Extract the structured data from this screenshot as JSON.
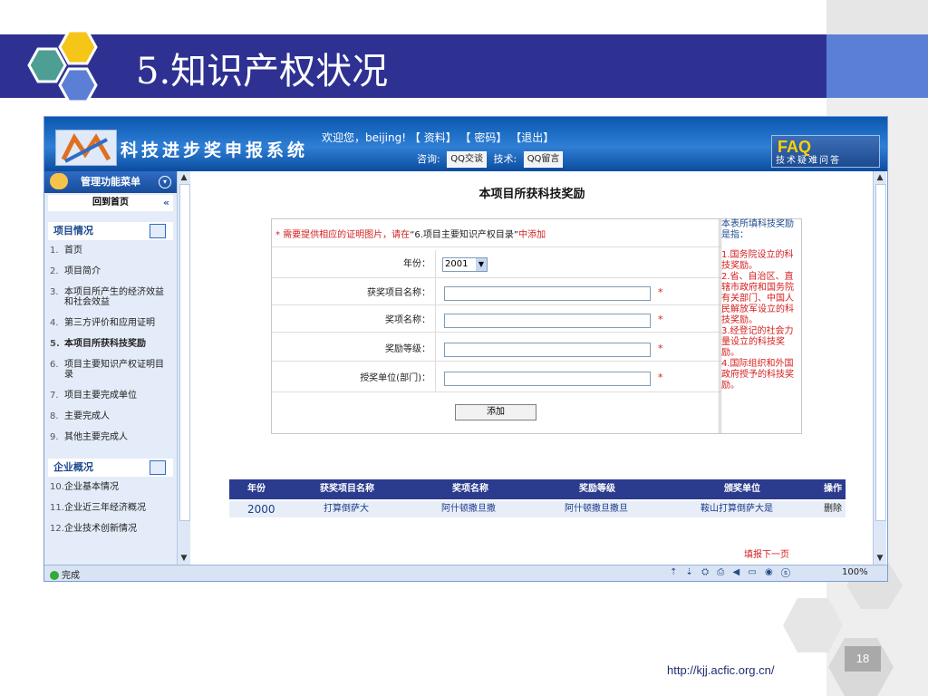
{
  "slide": {
    "title": "5.知识产权状况",
    "url": "http://kjj.acfic.org.cn/",
    "page_number": "18",
    "colors": {
      "title_bar": "#2e3192",
      "accent": "#5b7fd4"
    }
  },
  "app": {
    "name": "科技进步奖申报系统",
    "welcome": "欢迎您，beijing!",
    "links": [
      "【 资料】",
      "【 密码】",
      "【退出】"
    ],
    "consult_label": "咨询:",
    "qq_chat": "QQ交谈",
    "tech_label": "技术:",
    "qq_msg": "QQ留言",
    "faq_big": "FAQ",
    "faq_small": "技术疑难问答"
  },
  "sidebar": {
    "menu_title": "管理功能菜单",
    "back_home": "回到首页",
    "group1": "项目情况",
    "items": [
      {
        "idx": "1.",
        "label": "首页"
      },
      {
        "idx": "2.",
        "label": "项目简介"
      },
      {
        "idx": "3.",
        "label": "本项目所产生的经济效益和社会效益"
      },
      {
        "idx": "4.",
        "label": "第三方评价和应用证明"
      },
      {
        "idx": "5.",
        "label": "本项目所获科技奖励"
      },
      {
        "idx": "6.",
        "label": "项目主要知识产权证明目录"
      },
      {
        "idx": "7.",
        "label": "项目主要完成单位"
      },
      {
        "idx": "8.",
        "label": "主要完成人"
      },
      {
        "idx": "9.",
        "label": "其他主要完成人"
      }
    ],
    "group2": "企业概况",
    "items2": [
      {
        "idx": "10.",
        "label": "企业基本情况"
      },
      {
        "idx": "11.",
        "label": "企业近三年经济概况"
      },
      {
        "idx": "12.",
        "label": "企业技术创新情况"
      }
    ]
  },
  "main": {
    "page_title": "本项目所获科技奖励",
    "notice_prefix": "* 需要提供相应的证明图片，请在",
    "notice_link": "“6.项目主要知识产权目录”",
    "notice_suffix": "中添加",
    "year_label": "年份：",
    "year_value": "2001",
    "award_project_label": "获奖项目名称：",
    "award_name_label": "奖项名称：",
    "award_level_label": "奖励等级：",
    "award_unit_label": "授奖单位(部门)：",
    "add_button": "添加",
    "note_title": "本表所填科技奖励是指：",
    "note_items": [
      "1.国务院设立的科技奖励。",
      "2.省、自治区、直辖市政府和国务院有关部门、中国人民解放军设立的科技奖励。",
      "3.经登记的社会力量设立的科技奖励。",
      "4.国际组织和外国政府授予的科技奖励。"
    ],
    "table_headers": [
      "年份",
      "获奖项目名称",
      "奖项名称",
      "奖励等级",
      "颁奖单位",
      "操作"
    ],
    "table_rows": [
      [
        "2000",
        "打算倒萨大",
        "阿什顿撒旦撒",
        "阿什顿撒旦撒旦",
        "鞍山打算倒萨大是",
        "删除"
      ]
    ],
    "next_page": "填报下一页"
  },
  "status": {
    "done": "完成",
    "zoom": "100%"
  }
}
